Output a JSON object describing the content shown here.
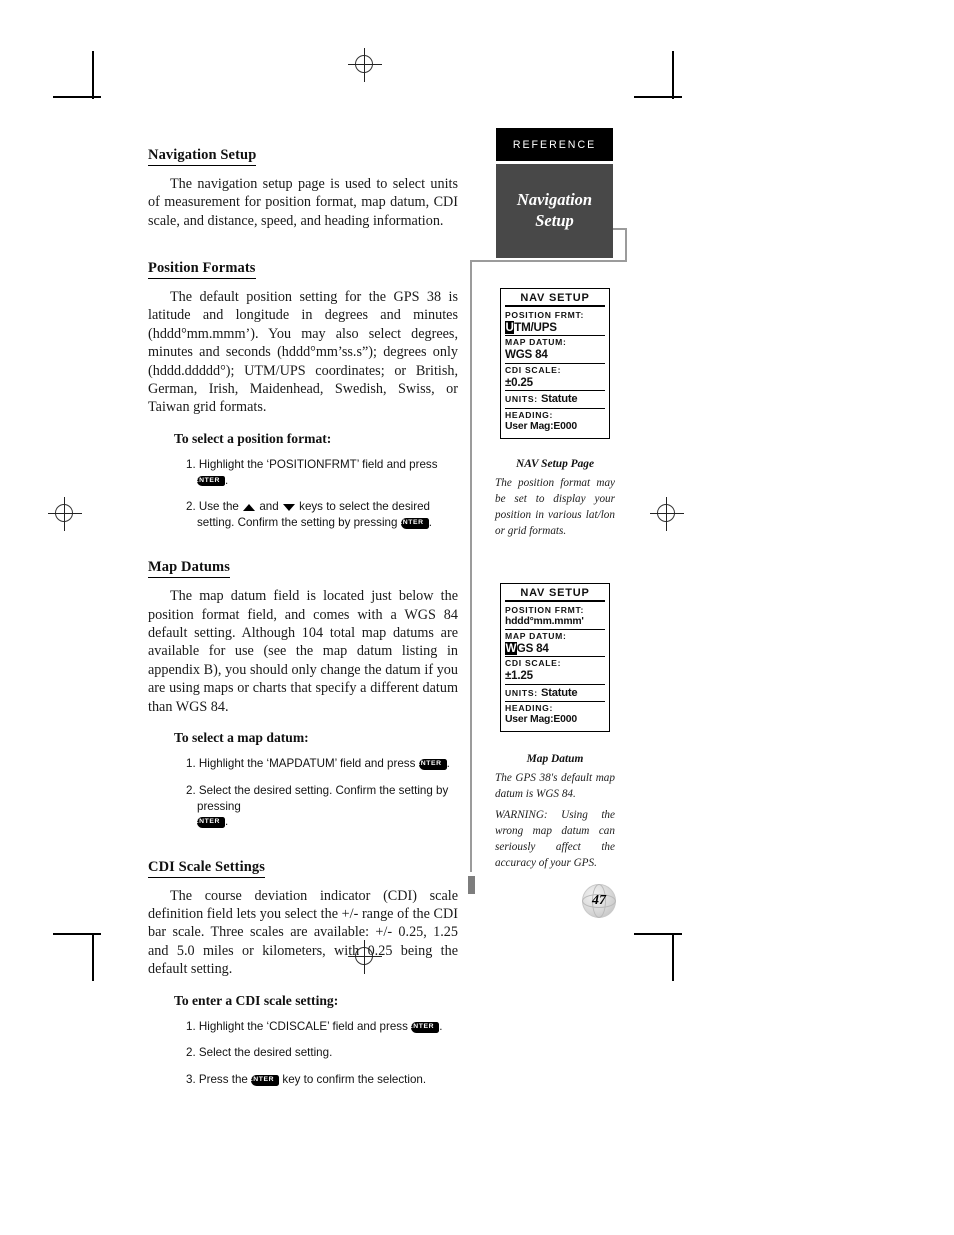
{
  "header": {
    "reference_tab": "REFERENCE",
    "chapter_line1": "Navigation",
    "chapter_line2": "Setup"
  },
  "page_number": "47",
  "content": {
    "s1_heading": "Navigation Setup",
    "s1_par": "The navigation setup page is used to select units of measurement for position format, map datum, CDI scale, and distance, speed, and heading information.",
    "s2_heading": "Position Formats",
    "s2_par": "The default position setting for the GPS 38 is latitude and longitude in degrees and minutes (hddd°mm.mmm’). You may also select degrees, minutes and seconds (hddd°mm’ss.s”); degrees only (hddd.ddddd°); UTM/UPS coordinates; or British, German, Irish, Maidenhead, Swedish, Swiss, or Taiwan grid formats.",
    "s2_steps_heading": "To select a position format:",
    "s2_step1_a": "1. Highlight the ‘POSITIONFRMT’ field and press",
    "s2_step1_b": ".",
    "s2_step2_a": "2. Use the",
    "s2_step2_b": "and",
    "s2_step2_c": "keys to select the desired setting. Confirm the setting by pressing",
    "s2_step2_d": ".",
    "s3_heading": "Map Datums",
    "s3_par": "The map datum field is located just below the position format field, and comes with a WGS 84 default setting. Although 104 total map datums are available for use (see the map datum listing in appendix B), you should only change the datum if you are using maps or charts that specify a different datum than WGS 84.",
    "s3_steps_heading": "To select a map datum:",
    "s3_step1_a": "1. Highlight the ‘MAPDATUM’ field and press",
    "s3_step1_b": ".",
    "s3_step2_a": "2. Select the desired setting. Confirm the setting by pressing",
    "s3_step2_b": ".",
    "s4_heading": "CDI Scale Settings",
    "s4_par": "The course deviation indicator (CDI) scale definition field lets you select the +/- range of the CDI bar scale. Three scales are available: +/- 0.25, 1.25 and 5.0 miles or kilometers, with 0.25 being the default setting.",
    "s4_steps_heading": "To enter a CDI scale setting:",
    "s4_step1_a": "1. Highlight the ‘CDISCALE’ field and press",
    "s4_step1_b": ".",
    "s4_step2": "2. Select the desired setting.",
    "s4_step3_a": "3. Press the",
    "s4_step3_b": "key to confirm the selection."
  },
  "key_labels": {
    "enter": "ENTER"
  },
  "figures": [
    {
      "screen": {
        "title": "NAV SETUP",
        "position_format_label": "POSITION FRMT:",
        "position_format_value_hl": "U",
        "position_format_value_rest": "TM/UPS",
        "map_datum_label": "MAP DATUM:",
        "map_datum_value_hl": "",
        "map_datum_value_rest": "WGS 84",
        "cdi_scale_label": "CDI SCALE:",
        "cdi_scale_value": "±0.25",
        "units_label": "UNITS:",
        "units_value": "Statute",
        "heading_label": "HEADING:",
        "heading_value": "User Mag:E000"
      },
      "caption_title": "NAV Setup Page",
      "caption_body": [
        "The position format may be set to display your position in various lat/lon or grid formats."
      ]
    },
    {
      "screen": {
        "title": "NAV SETUP",
        "position_format_label": "POSITION FRMT:",
        "position_format_value_hl": "",
        "position_format_value_rest": "hddd°mm.mmm'",
        "map_datum_label": "MAP DATUM:",
        "map_datum_value_hl": "W",
        "map_datum_value_rest": "GS 84",
        "cdi_scale_label": "CDI SCALE:",
        "cdi_scale_value": "±1.25",
        "units_label": "UNITS:",
        "units_value": "Statute",
        "heading_label": "HEADING:",
        "heading_value": "User Mag:E000"
      },
      "caption_title": "Map Datum",
      "caption_body": [
        "The GPS 38's default map datum is WGS 84.",
        "WARNING: Using the wrong map datum can seriously affect the accuracy of your GPS."
      ]
    }
  ]
}
